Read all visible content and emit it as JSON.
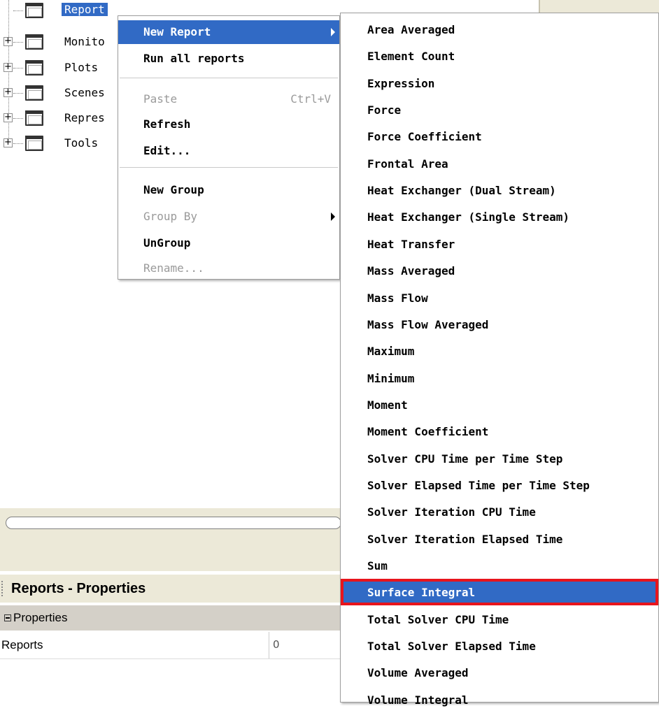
{
  "tree": {
    "items": [
      {
        "label": "Report",
        "expandable": false,
        "selected": true
      },
      {
        "label": "Monito",
        "expandable": true,
        "selected": false
      },
      {
        "label": "Plots",
        "expandable": true,
        "selected": false
      },
      {
        "label": "Scenes",
        "expandable": true,
        "selected": false
      },
      {
        "label": "Repres",
        "expandable": true,
        "selected": false
      },
      {
        "label": "Tools",
        "expandable": true,
        "selected": false
      }
    ]
  },
  "context_menu": {
    "new_report": "New Report",
    "run_all_reports": "Run all reports",
    "paste": "Paste",
    "paste_shortcut": "Ctrl+V",
    "refresh": "Refresh",
    "edit": "Edit...",
    "new_group": "New Group",
    "group_by": "Group By",
    "ungroup": "UnGroup",
    "rename": "Rename..."
  },
  "submenu": {
    "items": [
      "Area Averaged",
      "Element Count",
      "Expression",
      "Force",
      "Force Coefficient",
      "Frontal Area",
      "Heat Exchanger (Dual Stream)",
      "Heat Exchanger (Single Stream)",
      "Heat Transfer",
      "Mass Averaged",
      "Mass Flow",
      "Mass Flow Averaged",
      "Maximum",
      "Minimum",
      "Moment",
      "Moment Coefficient",
      "Solver CPU Time per Time Step",
      "Solver Elapsed Time per Time Step",
      "Solver Iteration CPU Time",
      "Solver Iteration Elapsed Time",
      "Sum",
      "Surface Integral",
      "Total Solver CPU Time",
      "Total Solver Elapsed Time",
      "Volume Averaged",
      "Volume Integral"
    ],
    "highlighted_item": "Surface Integral"
  },
  "properties_panel": {
    "title": "Reports - Properties",
    "group": "Properties",
    "rows": [
      {
        "key": "Reports",
        "value": "0"
      }
    ]
  },
  "colors": {
    "selection": "#316ac5",
    "highlight_border": "#e8141c",
    "panel_bg": "#ece9d8"
  }
}
